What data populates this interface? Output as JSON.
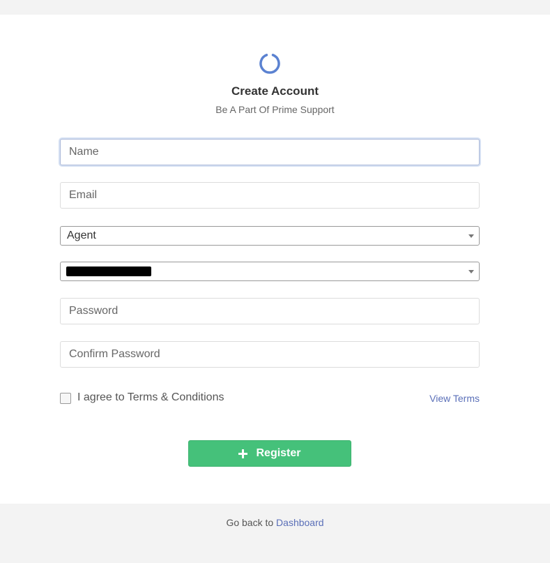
{
  "header": {
    "title": "Create Account",
    "subtitle": "Be A Part Of Prime Support",
    "logo_icon": "circle-notch-icon",
    "accent_color": "#5b82d1"
  },
  "form": {
    "name": {
      "placeholder": "Name",
      "value": ""
    },
    "email": {
      "placeholder": "Email",
      "value": ""
    },
    "role_select": {
      "selected": "Agent"
    },
    "second_select": {
      "selected": ""
    },
    "password": {
      "placeholder": "Password",
      "value": ""
    },
    "confirm_password": {
      "placeholder": "Confirm Password",
      "value": ""
    },
    "agree_label": "I agree to Terms & Conditions",
    "agree_checked": false,
    "view_terms_label": "View Terms",
    "register_label": "Register",
    "register_icon": "plus-icon",
    "register_color": "#45c17a"
  },
  "footer": {
    "prefix": "Go back to",
    "link_label": "Dashboard"
  }
}
